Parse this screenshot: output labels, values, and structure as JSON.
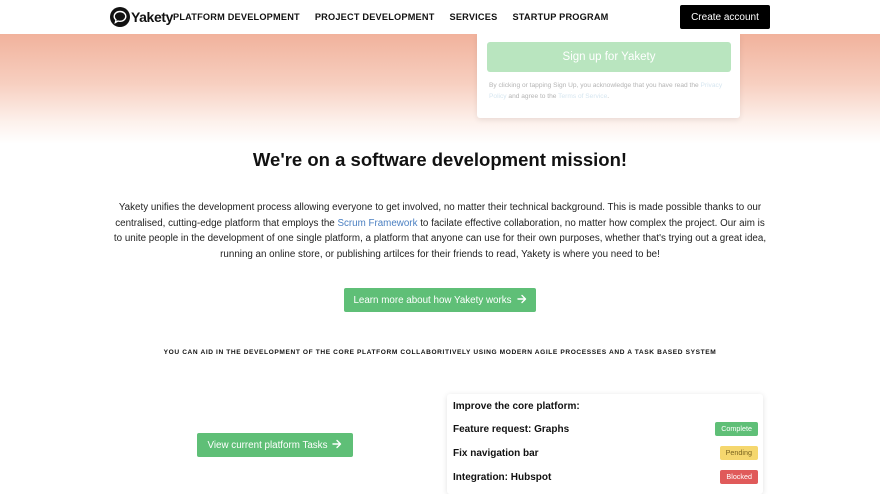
{
  "header": {
    "logo_text": "Yakety",
    "nav": [
      "PLATFORM DEVELOPMENT",
      "PROJECT DEVELOPMENT",
      "SERVICES",
      "STARTUP PROGRAM"
    ],
    "create_account": "Create account"
  },
  "signup": {
    "button": "Sign up for Yakety",
    "terms_before": "By clicking or tapping Sign Up, you acknowledge that you have read the ",
    "privacy_link": "Privacy Policy",
    "terms_middle": " and agree to the ",
    "terms_link": "Terms of Service",
    "terms_end": "."
  },
  "mission": {
    "title": "We're on a software development mission!",
    "text_before": "Yakety unifies the development process allowing everyone to get involved, no matter their technical background. This is made possible thanks to our centralised, cutting-edge platform that employs the ",
    "scrum_link": "Scrum Framework",
    "text_after": " to facilate effective collaboration, no matter how complex the project. Our aim is to unite people in the development of one single platform, a platform that anyone can use for their own purposes, whether that's trying out a great idea, running an online store, or publishing artilces for their friends to read, Yakety is where you need to be!",
    "learn_button": "Learn more about how Yakety works"
  },
  "aid_text": "YOU CAN AID IN THE DEVELOPMENT OF THE CORE PLATFORM COLLABORITIVELY USING MODERN AGILE PROCESSES AND A TASK BASED SYSTEM",
  "tasks_button": "View current platform Tasks",
  "task_card": {
    "title": "Improve the core platform:",
    "tasks": [
      {
        "name": "Feature request: Graphs",
        "status": "Complete",
        "color": "#5fbf77"
      },
      {
        "name": "Fix navigation bar",
        "status": "Pending",
        "color": "#f5d76e"
      },
      {
        "name": "Integration: Hubspot",
        "status": "Blocked",
        "color": "#e05a5a"
      }
    ]
  },
  "colors": {
    "accent_green": "#5fbf77",
    "signup_green": "#b9e5bf",
    "link_blue": "#4a7fc1",
    "hero_peach": "#f1b29c"
  }
}
